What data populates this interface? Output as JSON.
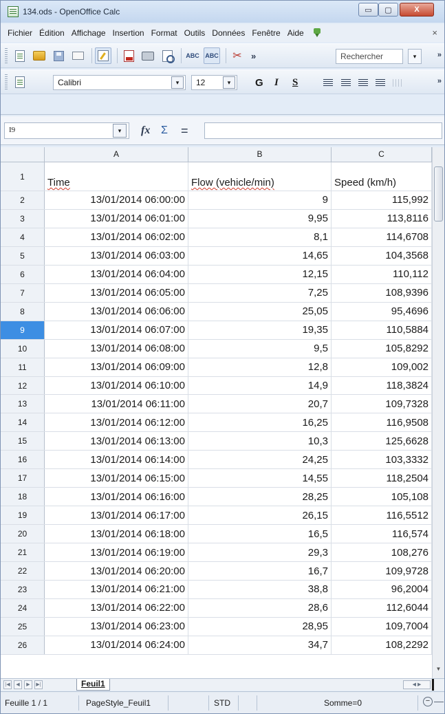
{
  "window": {
    "title": "134.ods - OpenOffice Calc",
    "minimize_glyph": "▭",
    "maximize_glyph": "▢",
    "close_glyph": "X"
  },
  "menu": {
    "items": [
      "Fichier",
      "Édition",
      "Affichage",
      "Insertion",
      "Format",
      "Outils",
      "Données",
      "Fenêtre",
      "Aide"
    ],
    "close_glyph": "×"
  },
  "toolbar": {
    "search_placeholder": "Rechercher",
    "dropdown_glyph": "▾",
    "more_glyph": "»",
    "cut_glyph": "✂",
    "spell_label": "ABC"
  },
  "formatting": {
    "font_name": "Calibri",
    "font_size": "12",
    "bold_label": "G",
    "italic_label": "I",
    "underline_label": "S"
  },
  "formula_bar": {
    "cell_reference": "I9",
    "fx_label": "fx",
    "sum_label": "Σ",
    "equal_label": "="
  },
  "sheet": {
    "column_headers": [
      "A",
      "B",
      "C"
    ],
    "header_row": {
      "row_number": "1",
      "a": "Time",
      "b": "Flow (vehicle/min)",
      "c": "Speed (km/h)"
    },
    "selected_row": "9",
    "rows": [
      {
        "n": "2",
        "time": "13/01/2014 06:00:00",
        "flow": "9",
        "speed": "115,992"
      },
      {
        "n": "3",
        "time": "13/01/2014 06:01:00",
        "flow": "9,95",
        "speed": "113,8116"
      },
      {
        "n": "4",
        "time": "13/01/2014 06:02:00",
        "flow": "8,1",
        "speed": "114,6708"
      },
      {
        "n": "5",
        "time": "13/01/2014 06:03:00",
        "flow": "14,65",
        "speed": "104,3568"
      },
      {
        "n": "6",
        "time": "13/01/2014 06:04:00",
        "flow": "12,15",
        "speed": "110,112"
      },
      {
        "n": "7",
        "time": "13/01/2014 06:05:00",
        "flow": "7,25",
        "speed": "108,9396"
      },
      {
        "n": "8",
        "time": "13/01/2014 06:06:00",
        "flow": "25,05",
        "speed": "95,4696"
      },
      {
        "n": "9",
        "time": "13/01/2014 06:07:00",
        "flow": "19,35",
        "speed": "110,5884"
      },
      {
        "n": "10",
        "time": "13/01/2014 06:08:00",
        "flow": "9,5",
        "speed": "105,8292"
      },
      {
        "n": "11",
        "time": "13/01/2014 06:09:00",
        "flow": "12,8",
        "speed": "109,002"
      },
      {
        "n": "12",
        "time": "13/01/2014 06:10:00",
        "flow": "14,9",
        "speed": "118,3824"
      },
      {
        "n": "13",
        "time": "13/01/2014 06:11:00",
        "flow": "20,7",
        "speed": "109,7328"
      },
      {
        "n": "14",
        "time": "13/01/2014 06:12:00",
        "flow": "16,25",
        "speed": "116,9508"
      },
      {
        "n": "15",
        "time": "13/01/2014 06:13:00",
        "flow": "10,3",
        "speed": "125,6628"
      },
      {
        "n": "16",
        "time": "13/01/2014 06:14:00",
        "flow": "24,25",
        "speed": "103,3332"
      },
      {
        "n": "17",
        "time": "13/01/2014 06:15:00",
        "flow": "14,55",
        "speed": "118,2504"
      },
      {
        "n": "18",
        "time": "13/01/2014 06:16:00",
        "flow": "28,25",
        "speed": "105,108"
      },
      {
        "n": "19",
        "time": "13/01/2014 06:17:00",
        "flow": "26,15",
        "speed": "116,5512"
      },
      {
        "n": "20",
        "time": "13/01/2014 06:18:00",
        "flow": "16,5",
        "speed": "116,574"
      },
      {
        "n": "21",
        "time": "13/01/2014 06:19:00",
        "flow": "29,3",
        "speed": "108,276"
      },
      {
        "n": "22",
        "time": "13/01/2014 06:20:00",
        "flow": "16,7",
        "speed": "109,9728"
      },
      {
        "n": "23",
        "time": "13/01/2014 06:21:00",
        "flow": "38,8",
        "speed": "96,2004"
      },
      {
        "n": "24",
        "time": "13/01/2014 06:22:00",
        "flow": "28,6",
        "speed": "112,6044"
      },
      {
        "n": "25",
        "time": "13/01/2014 06:23:00",
        "flow": "28,95",
        "speed": "109,7004"
      },
      {
        "n": "26",
        "time": "13/01/2014 06:24:00",
        "flow": "34,7",
        "speed": "108,2292"
      }
    ],
    "tab_name": "Feuil1"
  },
  "status": {
    "sheet": "Feuille 1 / 1",
    "page_style": "PageStyle_Feuil1",
    "mode": "STD",
    "sum": "Somme=0",
    "zoom_glyph": "−"
  }
}
